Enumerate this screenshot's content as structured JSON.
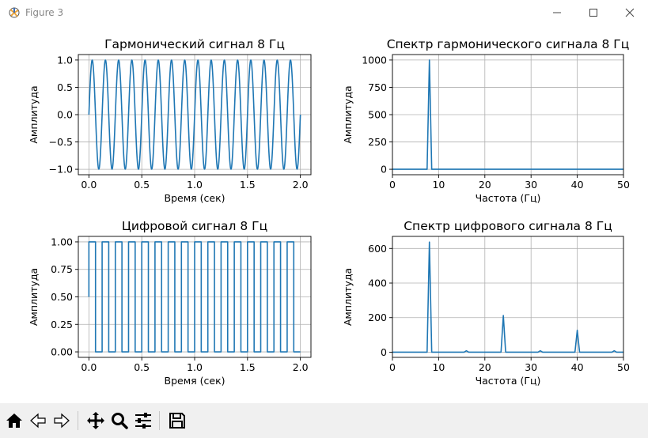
{
  "window": {
    "title": "Figure 3",
    "controls": [
      "minimize",
      "maximize",
      "close"
    ]
  },
  "toolbar": {
    "buttons": [
      "home-icon",
      "back-icon",
      "forward-icon",
      "pan-icon",
      "zoom-icon",
      "configure-subplots-icon",
      "save-icon"
    ]
  },
  "chart_data": [
    {
      "type": "line",
      "title": "Гармонический сигнал 8 Гц",
      "xlabel": "Время (сек)",
      "ylabel": "Амплитуда",
      "xlim": [
        -0.1,
        2.1
      ],
      "ylim": [
        -1.1,
        1.1
      ],
      "xticks": [
        "0.0",
        "0.5",
        "1.0",
        "1.5",
        "2.0"
      ],
      "yticks": [
        "−1.0",
        "−0.5",
        "0.0",
        "0.5",
        "1.0"
      ],
      "grid": true,
      "color": "#1f77b4",
      "signal": {
        "kind": "sine",
        "frequency": 8,
        "amplitude": 1,
        "t_start": 0,
        "t_end": 2
      }
    },
    {
      "type": "line",
      "title": "Спектр гармонического сигнала 8 Гц",
      "xlabel": "Частота (Гц)",
      "ylabel": "Амплитуда",
      "xlim": [
        0,
        50
      ],
      "ylim": [
        -50,
        1050
      ],
      "xticks": [
        "0",
        "10",
        "20",
        "30",
        "40",
        "50"
      ],
      "yticks": [
        "0",
        "250",
        "500",
        "750",
        "1000"
      ],
      "grid": true,
      "color": "#1f77b4",
      "peaks": [
        {
          "x": 8,
          "y": 1000
        }
      ]
    },
    {
      "type": "line",
      "title": "Цифровой сигнал 8 Гц",
      "xlabel": "Время (сек)",
      "ylabel": "Амплитуда",
      "xlim": [
        -0.1,
        2.1
      ],
      "ylim": [
        -0.05,
        1.05
      ],
      "xticks": [
        "0.0",
        "0.5",
        "1.0",
        "1.5",
        "2.0"
      ],
      "yticks": [
        "0.00",
        "0.25",
        "0.50",
        "0.75",
        "1.00"
      ],
      "grid": true,
      "color": "#1f77b4",
      "signal": {
        "kind": "square",
        "frequency": 8,
        "low": 0,
        "high": 1,
        "t_start": 0,
        "t_end": 2,
        "initial": 0.5
      }
    },
    {
      "type": "line",
      "title": "Спектр цифрового сигнала 8 Гц",
      "xlabel": "Частота (Гц)",
      "ylabel": "Амплитуда",
      "xlim": [
        0,
        50
      ],
      "ylim": [
        -30,
        670
      ],
      "xticks": [
        "0",
        "10",
        "20",
        "30",
        "40",
        "50"
      ],
      "yticks": [
        "0",
        "200",
        "400",
        "600"
      ],
      "grid": true,
      "color": "#1f77b4",
      "peaks": [
        {
          "x": 8,
          "y": 637
        },
        {
          "x": 16,
          "y": 8
        },
        {
          "x": 24,
          "y": 212
        },
        {
          "x": 32,
          "y": 8
        },
        {
          "x": 40,
          "y": 127
        },
        {
          "x": 48,
          "y": 8
        }
      ]
    }
  ]
}
